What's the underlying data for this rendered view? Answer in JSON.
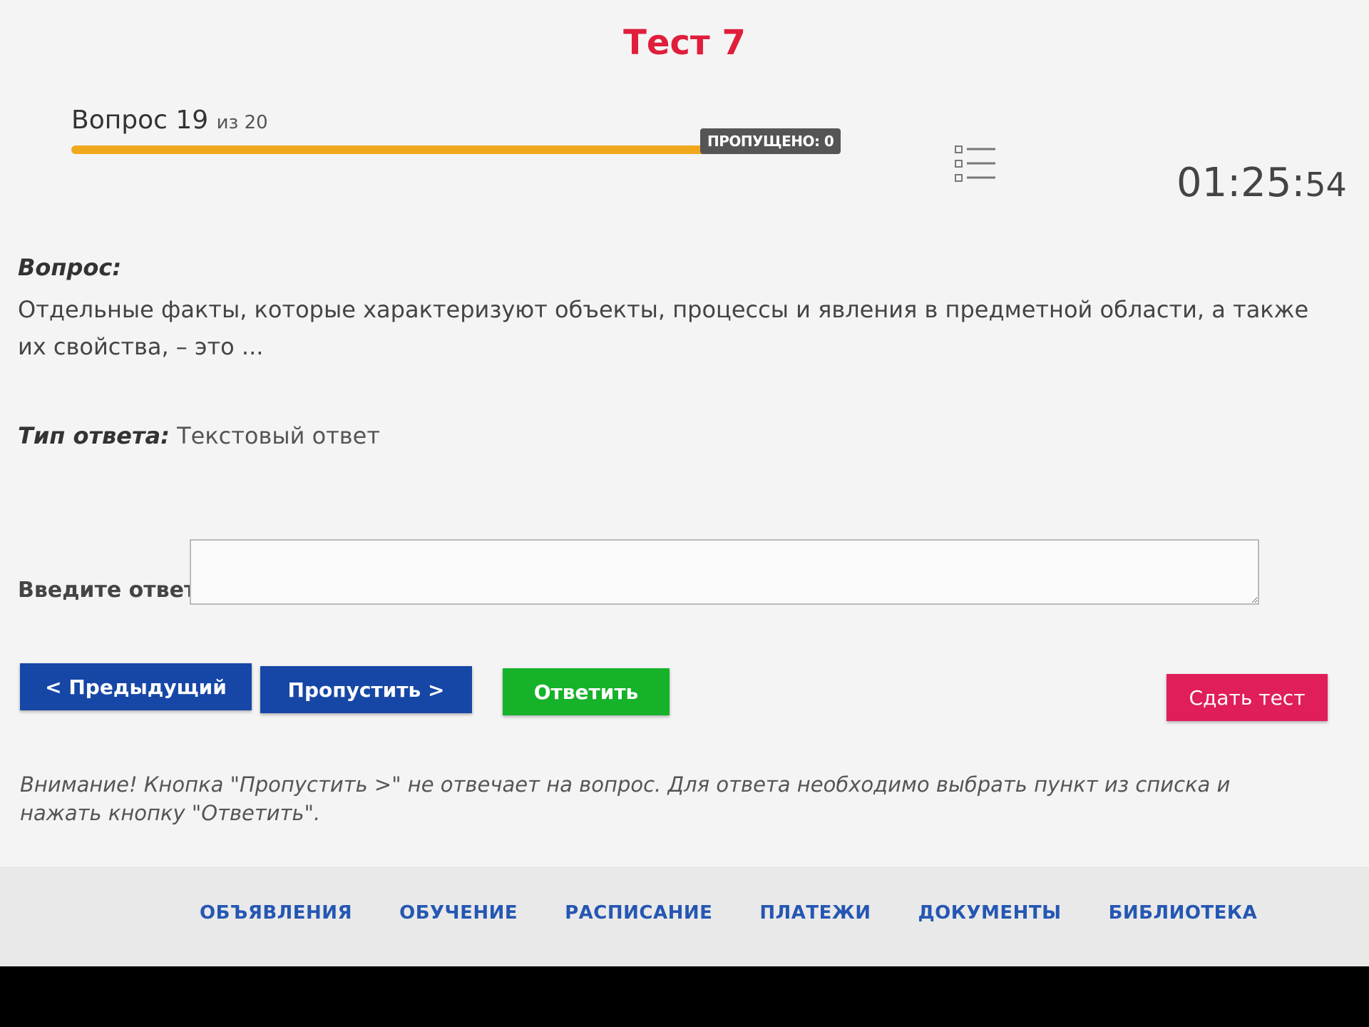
{
  "page": {
    "title": "Тест 7"
  },
  "progress": {
    "question_prefix": "Вопрос 19",
    "question_total": "из 20",
    "current": 19,
    "total": 20,
    "fill_fraction": 0.9,
    "skipped_label": "ПРОПУЩЕНО: 0"
  },
  "timer": {
    "hm": "01:25:",
    "sec": "54"
  },
  "question": {
    "label": "Вопрос:",
    "text": "Отдельные факты, которые характеризуют объекты, процессы и явления в предметной области, а также их свойства, – это ..."
  },
  "answer_type": {
    "label": "Тип ответа:",
    "value": "Текстовый ответ"
  },
  "answer_input": {
    "label": "Введите ответ:",
    "value": ""
  },
  "buttons": {
    "prev": "< Предыдущий",
    "skip": "Пропустить >",
    "answer": "Ответить",
    "submit": "Сдать тест"
  },
  "warning": "Внимание! Кнопка \"Пропустить >\" не отвечает на вопрос. Для ответа необходимо выбрать пункт из списка и нажать кнопку \"Ответить\".",
  "footer": {
    "links": [
      "ОБЪЯВЛЕНИЯ",
      "ОБУЧЕНИЕ",
      "РАСПИСАНИЕ",
      "ПЛАТЕЖИ",
      "ДОКУМЕНТЫ",
      "БИБЛИОТЕКА"
    ]
  },
  "colors": {
    "title": "#e01e3c",
    "progress": "#f2a81d",
    "primary": "#1747a6",
    "success": "#16b22a",
    "danger": "#e01e5a",
    "link": "#2557b3"
  }
}
